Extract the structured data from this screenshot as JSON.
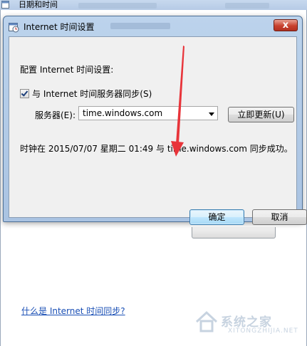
{
  "parent_window": {
    "title": "日期和时间",
    "link_text": "什么是 Internet 时间同步?"
  },
  "dialog": {
    "title": "Internet 时间设置",
    "close_glyph": "x",
    "heading": "配置 Internet 时间设置:",
    "sync_checkbox": {
      "label": "与 Internet 时间服务器同步(S)",
      "checked": true
    },
    "server_label": "服务器(E):",
    "server_value": "time.windows.com",
    "update_button": "立即更新(U)",
    "status_message": "时钟在 2015/07/07 星期二 01:49 与 time.windows.com 同步成功。",
    "ok_button": "确定",
    "cancel_button": "取消"
  },
  "watermark": {
    "text": "系统之家",
    "url": "XITONGZHIJIA.NET"
  },
  "colors": {
    "arrow": "#e8343a",
    "link": "#1a4fb5",
    "close": "#c8412f"
  }
}
